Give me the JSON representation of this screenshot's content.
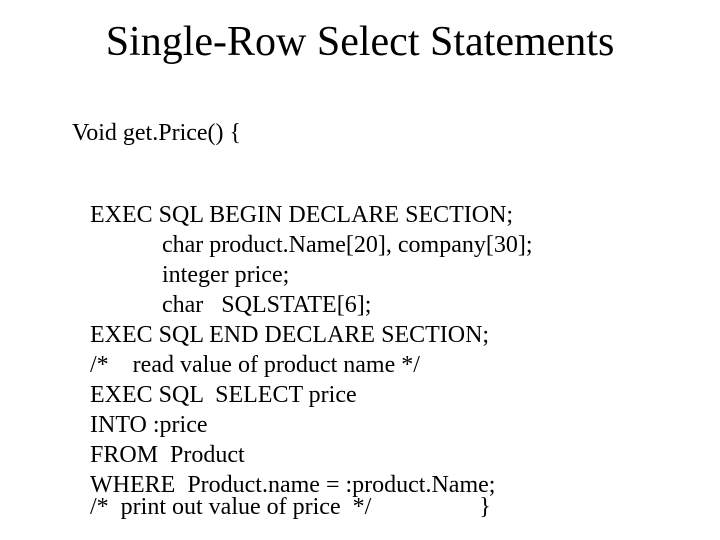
{
  "title": "Single-Row Select Statements",
  "subhead": "Void  get.Price() {",
  "code_lines": [
    "EXEC SQL BEGIN DECLARE SECTION;",
    "            char product.Name[20], company[30];",
    "            integer price;",
    "            char   SQLSTATE[6];",
    "EXEC SQL END DECLARE SECTION;",
    "/*    read value of product name */",
    "EXEC SQL  SELECT price",
    "INTO :price",
    "FROM  Product",
    "WHERE  Product.name = :product.Name;"
  ],
  "footer": "/*  print out value of price  */                  }"
}
